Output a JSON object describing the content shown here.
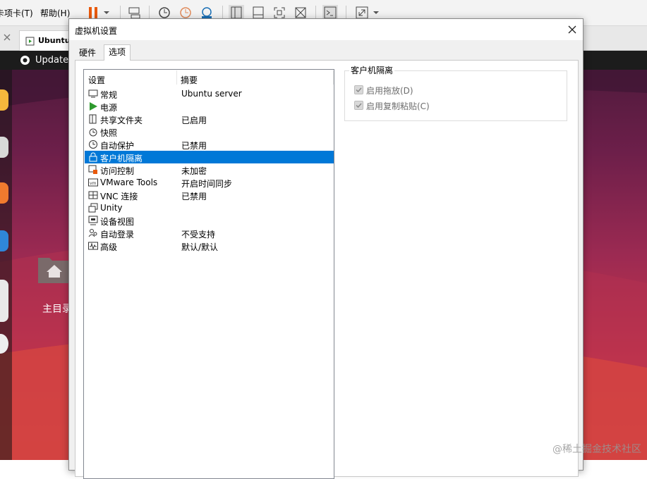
{
  "host": {
    "menus": [
      "卡项卡(T)",
      "帮助(H)"
    ],
    "vm_tab_label": "Ubuntu",
    "desktop_topbar_label": "Update",
    "desktop_folder_label": "主目录"
  },
  "dialog": {
    "title": "虚拟机设置",
    "tabs": [
      {
        "label": "硬件",
        "active": false
      },
      {
        "label": "选项",
        "active": true
      }
    ],
    "list": {
      "columns": [
        "设置",
        "摘要"
      ],
      "rows": [
        {
          "name": "常规",
          "summary": "Ubuntu server",
          "icon": "monitor-icon"
        },
        {
          "name": "电源",
          "summary": "",
          "icon": "play-icon"
        },
        {
          "name": "共享文件夹",
          "summary": "已启用",
          "icon": "shared-folder-icon"
        },
        {
          "name": "快照",
          "summary": "",
          "icon": "snapshot-icon"
        },
        {
          "name": "自动保护",
          "summary": "已禁用",
          "icon": "clock-icon"
        },
        {
          "name": "客户机隔离",
          "summary": "",
          "icon": "lock-icon",
          "selected": true
        },
        {
          "name": "访问控制",
          "summary": "未加密",
          "icon": "access-control-icon"
        },
        {
          "name": "VMware Tools",
          "summary": "开启时间同步",
          "icon": "vm-icon"
        },
        {
          "name": "VNC 连接",
          "summary": "已禁用",
          "icon": "vnc-icon"
        },
        {
          "name": "Unity",
          "summary": "",
          "icon": "unity-icon"
        },
        {
          "name": "设备视图",
          "summary": "",
          "icon": "device-view-icon"
        },
        {
          "name": "自动登录",
          "summary": "不受支持",
          "icon": "users-icon"
        },
        {
          "name": "高级",
          "summary": "默认/默认",
          "icon": "waveform-icon"
        }
      ]
    },
    "isolation": {
      "group_title": "客户机隔离",
      "options": [
        {
          "label": "启用拖放(D)",
          "checked": true,
          "disabled": true
        },
        {
          "label": "启用复制粘贴(C)",
          "checked": true,
          "disabled": true
        }
      ]
    }
  },
  "watermark": "@稀土掘金技术社区",
  "colors": {
    "selection": "#0078d7",
    "pause": "#e8590c",
    "power_green": "#2e9a2e"
  }
}
